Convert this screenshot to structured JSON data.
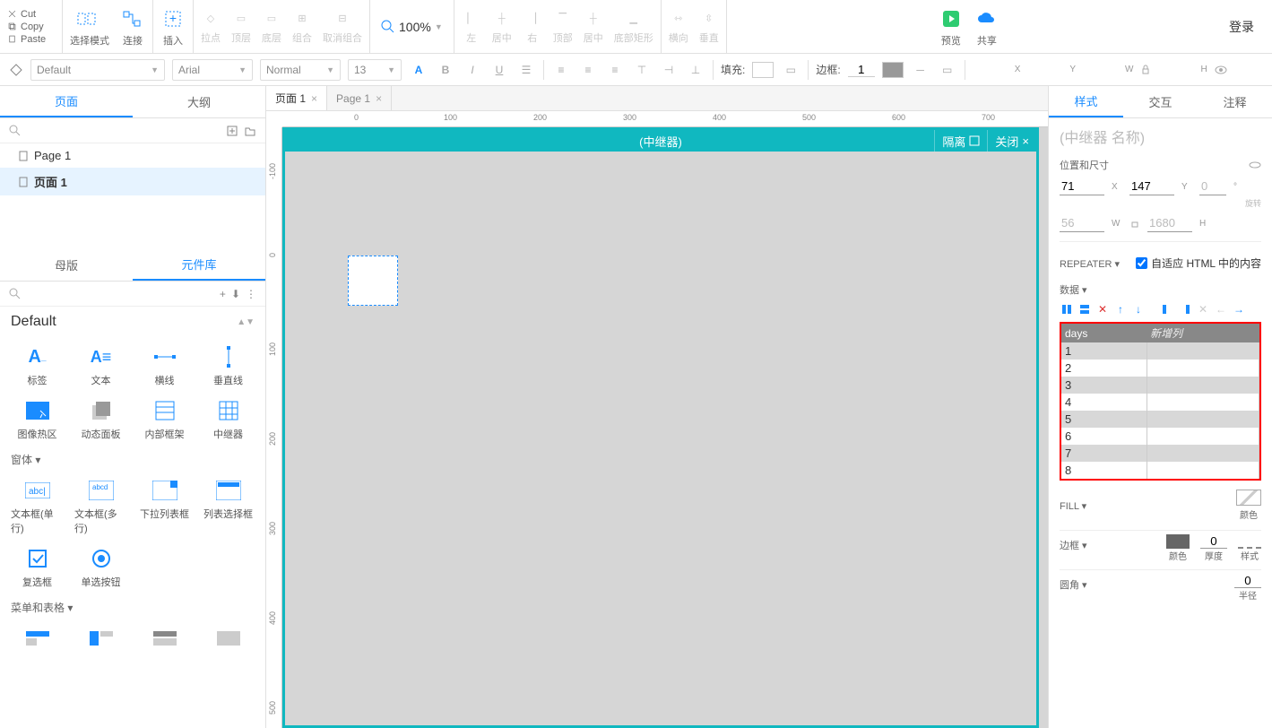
{
  "clip": {
    "cut": "Cut",
    "copy": "Copy",
    "paste": "Paste"
  },
  "ribbon": {
    "select_mode": "选择模式",
    "connect": "连接",
    "insert": "插入",
    "anchor": "拉点",
    "top": "顶层",
    "bottom": "底层",
    "group": "组合",
    "ungroup": "取消组合",
    "left": "左",
    "center_h": "居中",
    "right": "右",
    "top_a": "顶部",
    "middle": "居中",
    "bottom_a": "底部矩形",
    "horiz": "横向",
    "vert": "垂直",
    "preview": "预览",
    "share": "共享"
  },
  "zoom": "100%",
  "login": "登录",
  "fmt": {
    "style": "Default",
    "font": "Arial",
    "weight": "Normal",
    "size": "13",
    "fill_label": "填充:",
    "border_label": "边框:",
    "border_w": "1",
    "x": "X",
    "y": "Y",
    "w": "W",
    "h": "H"
  },
  "left_tabs": {
    "pages": "页面",
    "outline": "大纲"
  },
  "pages": [
    {
      "name": "Page 1",
      "active": false
    },
    {
      "name": "页面 1",
      "active": true
    }
  ],
  "lib_tabs": {
    "masters": "母版",
    "libraries": "元件库"
  },
  "lib_cat": "Default",
  "lib_items1": [
    "标签",
    "文本",
    "横线",
    "垂直线",
    "图像热区",
    "动态面板",
    "内部框架",
    "中继器"
  ],
  "lib_sec1": "窗体 ▾",
  "lib_items2": [
    "文本框(单行)",
    "文本框(多行)",
    "下拉列表框",
    "列表选择框",
    "复选框",
    "单选按钮"
  ],
  "lib_sec2": "菜单和表格 ▾",
  "doc_tabs": [
    {
      "name": "页面 1",
      "active": true
    },
    {
      "name": "Page 1",
      "active": false
    }
  ],
  "ruler_h": [
    "0",
    "100",
    "200",
    "300",
    "400",
    "500",
    "600",
    "700"
  ],
  "ruler_v": [
    "-100",
    "0",
    "100",
    "200",
    "300",
    "400",
    "500"
  ],
  "repeater": {
    "title": "(中继器)",
    "isolate": "隔离",
    "close": "关闭"
  },
  "right_tabs": {
    "style": "样式",
    "interact": "交互",
    "notes": "注释"
  },
  "r": {
    "name_placeholder": "(中继器 名称)",
    "pos_size": "位置和尺寸",
    "x": "71",
    "y": "147",
    "rot": "0",
    "rot_label": "旋转",
    "w": "56",
    "h": "1680",
    "repeater": "REPEATER ▾",
    "fit_html": "自适应 HTML 中的内容",
    "data": "数据 ▾",
    "col1": "days",
    "col2": "新增列",
    "rows": [
      "1",
      "2",
      "3",
      "4",
      "5",
      "6",
      "7",
      "8"
    ],
    "fill": "FILL ▾",
    "color": "颜色",
    "border": "边框 ▾",
    "thickness": "厚度",
    "thickness_v": "0",
    "style_lbl": "样式",
    "corner": "圆角 ▾",
    "radius": "半径",
    "radius_v": "0"
  }
}
